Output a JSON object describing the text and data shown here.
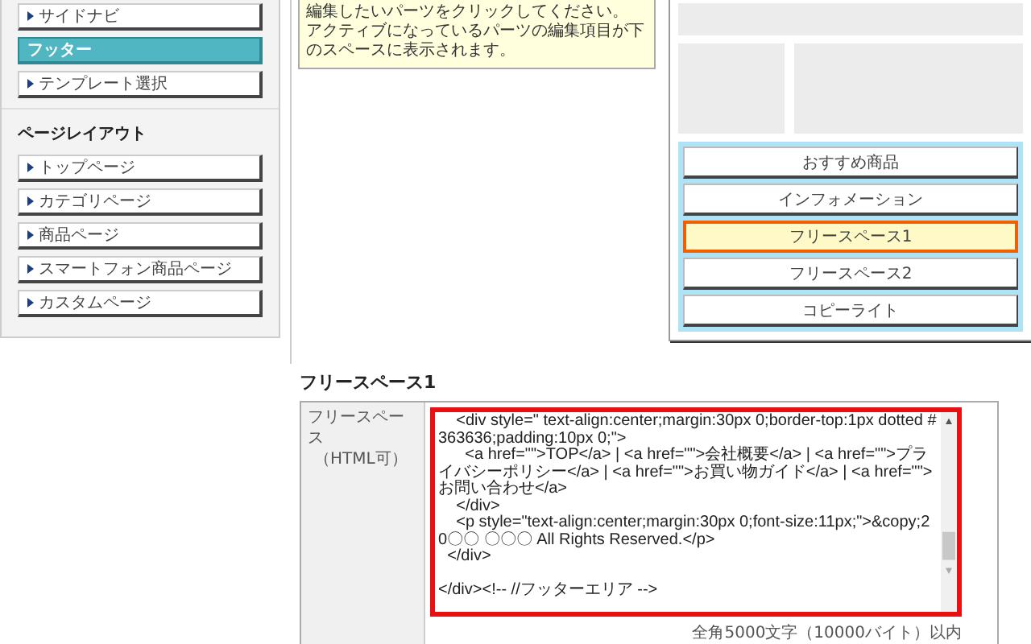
{
  "sidebar": {
    "items": [
      {
        "label": "サイドナビ",
        "selected": false
      },
      {
        "label": "フッター",
        "selected": true
      },
      {
        "label": "テンプレート選択",
        "selected": false
      }
    ],
    "section": {
      "title": "ページレイアウト",
      "items": [
        {
          "label": "トップページ",
          "selected": false
        },
        {
          "label": "カテゴリページ",
          "selected": false
        },
        {
          "label": "商品ページ",
          "selected": false
        },
        {
          "label": "スマートフォン商品ページ",
          "selected": false
        },
        {
          "label": "カスタムページ",
          "selected": false
        }
      ]
    }
  },
  "notice": {
    "lines": [
      "編集したいパーツをクリックしてください。",
      "アクティブになっているパーツの編集項目が下のスペースに表示されます。"
    ]
  },
  "preview": {
    "parts": [
      {
        "label": "おすすめ商品",
        "selected": false
      },
      {
        "label": "インフォメーション",
        "selected": false
      },
      {
        "label": "フリースペース1",
        "selected": true
      },
      {
        "label": "フリースペース2",
        "selected": false
      },
      {
        "label": "コピーライト",
        "selected": false
      }
    ]
  },
  "form": {
    "title": "フリースペース1",
    "field_label": "フリースペース",
    "field_sublabel": "（HTML可）",
    "value": "    <div style=\" text-align:center;margin:30px 0;border-top:1px dotted #363636;padding:10px 0;\">\n      <a href=\"\">TOP</a> | <a href=\"\">会社概要</a> | <a href=\"\">プライバシーポリシー</a> | <a href=\"\">お買い物ガイド</a> | <a href=\"\">お問い合わせ</a>\n    </div>\n    <p style=\"text-align:center;margin:30px 0;font-size:11px;\">&copy;20〇〇 〇〇〇 All Rights Reserved.</p>\n  </div>\n\n</div><!-- //フッターエリア -->",
    "hint": "全角5000文字（10000バイト）以内"
  }
}
